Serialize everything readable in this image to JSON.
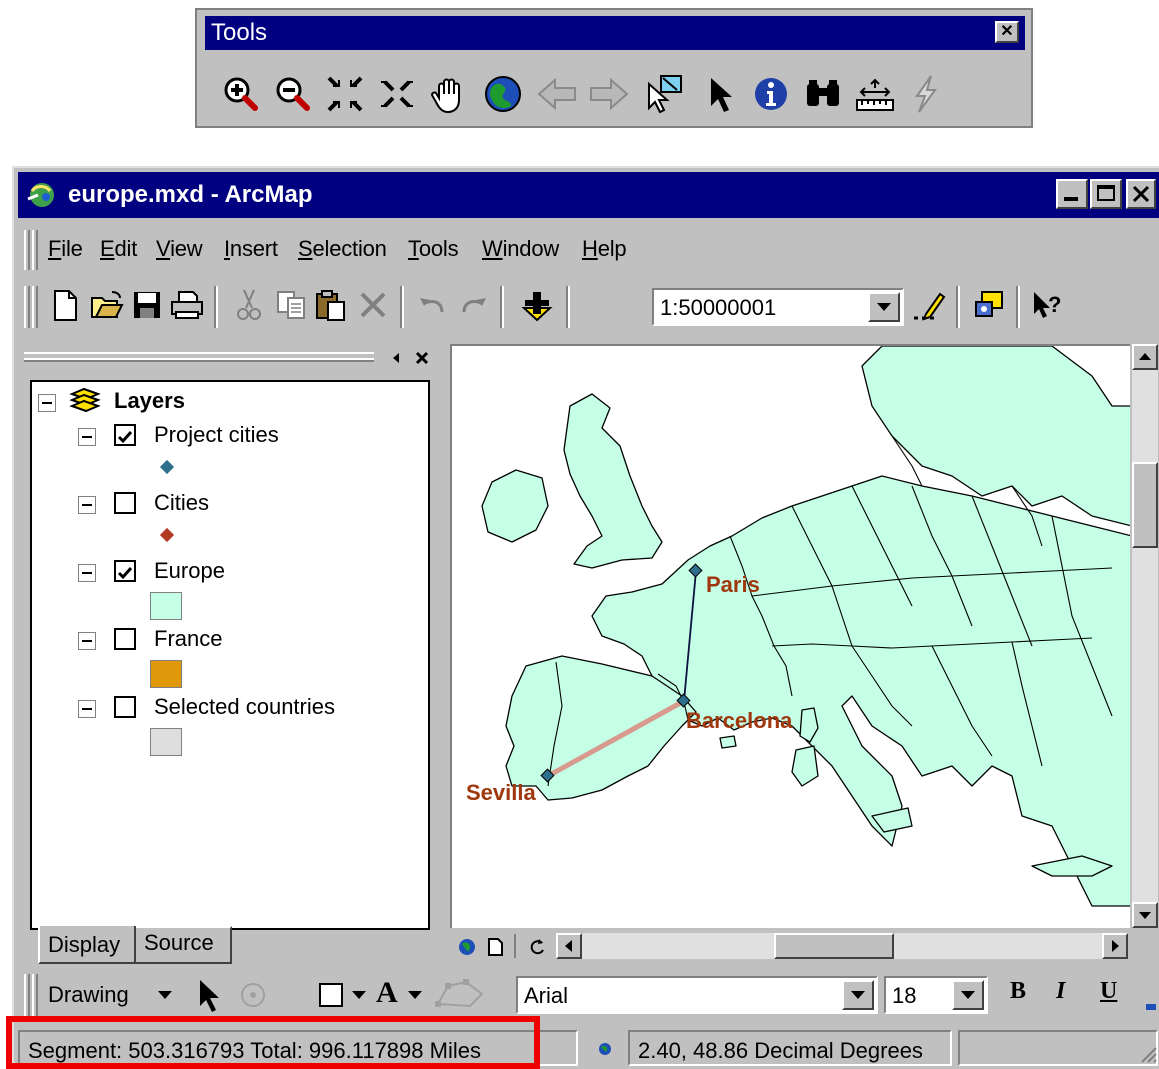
{
  "tools_toolbar": {
    "title": "Tools",
    "icons": [
      "zoom-in-icon",
      "zoom-out-icon",
      "fixed-zoom-in-icon",
      "fixed-zoom-out-icon",
      "pan-icon",
      "full-extent-icon",
      "back-icon",
      "forward-icon",
      "select-features-icon",
      "select-elements-icon",
      "identify-icon",
      "find-icon",
      "measure-icon",
      "hyperlink-icon"
    ]
  },
  "window": {
    "title": "europe.mxd - ArcMap"
  },
  "menu": {
    "items": [
      {
        "hot": "F",
        "rest": "ile"
      },
      {
        "hot": "E",
        "rest": "dit"
      },
      {
        "hot": "V",
        "rest": "iew"
      },
      {
        "hot": "I",
        "rest": "nsert"
      },
      {
        "hot": "S",
        "rest": "election"
      },
      {
        "hot": "T",
        "rest": "ools"
      },
      {
        "hot": "W",
        "rest": "indow"
      },
      {
        "hot": "H",
        "rest": "elp"
      }
    ]
  },
  "standard_toolbar": {
    "scale": "1:50000001"
  },
  "toc": {
    "root": "Layers",
    "layers": [
      {
        "name": "Project cities",
        "checked": true,
        "symbol_color": "#2d6f8c"
      },
      {
        "name": "Cities",
        "checked": false,
        "symbol_color": "#b33a22"
      },
      {
        "name": "Europe",
        "checked": true,
        "symbol_color": "#c4ffe6"
      },
      {
        "name": "France",
        "checked": false,
        "symbol_color": "#e0970a"
      },
      {
        "name": "Selected countries",
        "checked": false,
        "symbol_color": "#dedede"
      }
    ],
    "tabs": {
      "display": "Display",
      "source": "Source"
    }
  },
  "map": {
    "labels": {
      "paris": "Paris",
      "barcelona": "Barcelona",
      "sevilla": "Sevilla"
    },
    "land_color": "#c4ffe6",
    "label_color": "#a0380e"
  },
  "drawing_toolbar": {
    "label": "Drawing",
    "font": "Arial",
    "size": "18",
    "bold": "B",
    "italic": "I",
    "underline": "U"
  },
  "status": {
    "measure": "Segment: 503.316793  Total: 996.117898  Miles",
    "coords": "2.40, 48.86 Decimal Degrees"
  }
}
